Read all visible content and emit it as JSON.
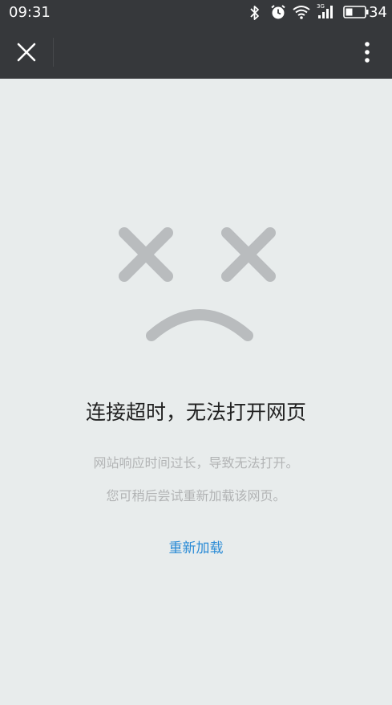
{
  "status_bar": {
    "time": "09:31",
    "battery_level": "34",
    "network_label": "3G",
    "icons": [
      "bluetooth-icon",
      "alarm-clock-icon",
      "wifi-icon",
      "signal-icon",
      "battery-icon"
    ]
  },
  "toolbar": {
    "close_icon": "close-icon",
    "more_icon": "more-vertical-icon"
  },
  "error": {
    "illustration_icon": "sad-face-icon",
    "title": "连接超时，无法打开网页",
    "description_line1": "网站响应时间过长，导致无法打开。",
    "description_line2": "您可稍后尝试重新加载该网页。",
    "reload_label": "重新加载"
  },
  "colors": {
    "toolbar_bg": "#36383b",
    "page_bg": "#e8ecec",
    "illustration": "#b9bcbe",
    "link": "#2a8bd6"
  }
}
